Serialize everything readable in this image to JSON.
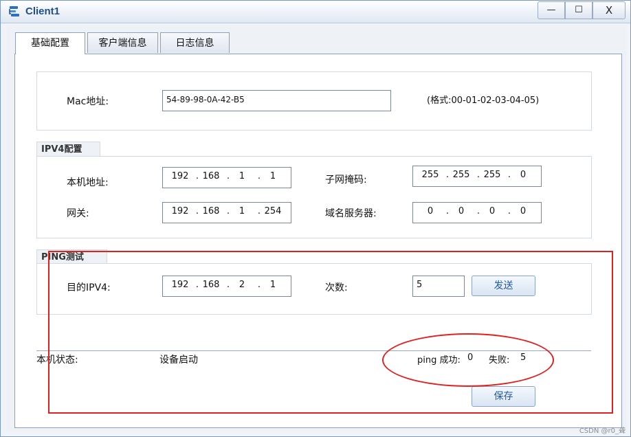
{
  "window": {
    "title": "Client1",
    "min_label": "—",
    "max_label": "☐",
    "close_label": "X"
  },
  "tabs": [
    "基础配置",
    "客户端信息",
    "日志信息"
  ],
  "mac": {
    "label": "Mac地址:",
    "value": "54-89-98-0A-42-B5",
    "format_hint": "(格式:00-01-02-03-04-05)"
  },
  "ipv4": {
    "section_title": "IPV4配置",
    "local_ip": {
      "label": "本机地址:",
      "octets": [
        "192",
        "168",
        "1",
        "1"
      ]
    },
    "subnet_mask": {
      "label": "子网掩码:",
      "octets": [
        "255",
        "255",
        "255",
        "0"
      ]
    },
    "gateway": {
      "label": "网关:",
      "octets": [
        "192",
        "168",
        "1",
        "254"
      ]
    },
    "dns": {
      "label": "域名服务器:",
      "octets": [
        "0",
        "0",
        "0",
        "0"
      ]
    }
  },
  "ping": {
    "section_title": "PING测试",
    "dest_label": "目的IPV4:",
    "dest_octets": [
      "192",
      "168",
      "2",
      "1"
    ],
    "count_label": "次数:",
    "count_value": "5",
    "send_label": "发送"
  },
  "status": {
    "label": "本机状态:",
    "value": "设备启动",
    "ping_success_label": "ping 成功:",
    "ping_success_value": "0",
    "fail_label": "失败:",
    "fail_value": "5"
  },
  "save_label": "保存",
  "watermark": "CSDN @r0_聋",
  "colors": {
    "annotation_red": "#e02020",
    "title_blue": "#1f4b8f"
  }
}
